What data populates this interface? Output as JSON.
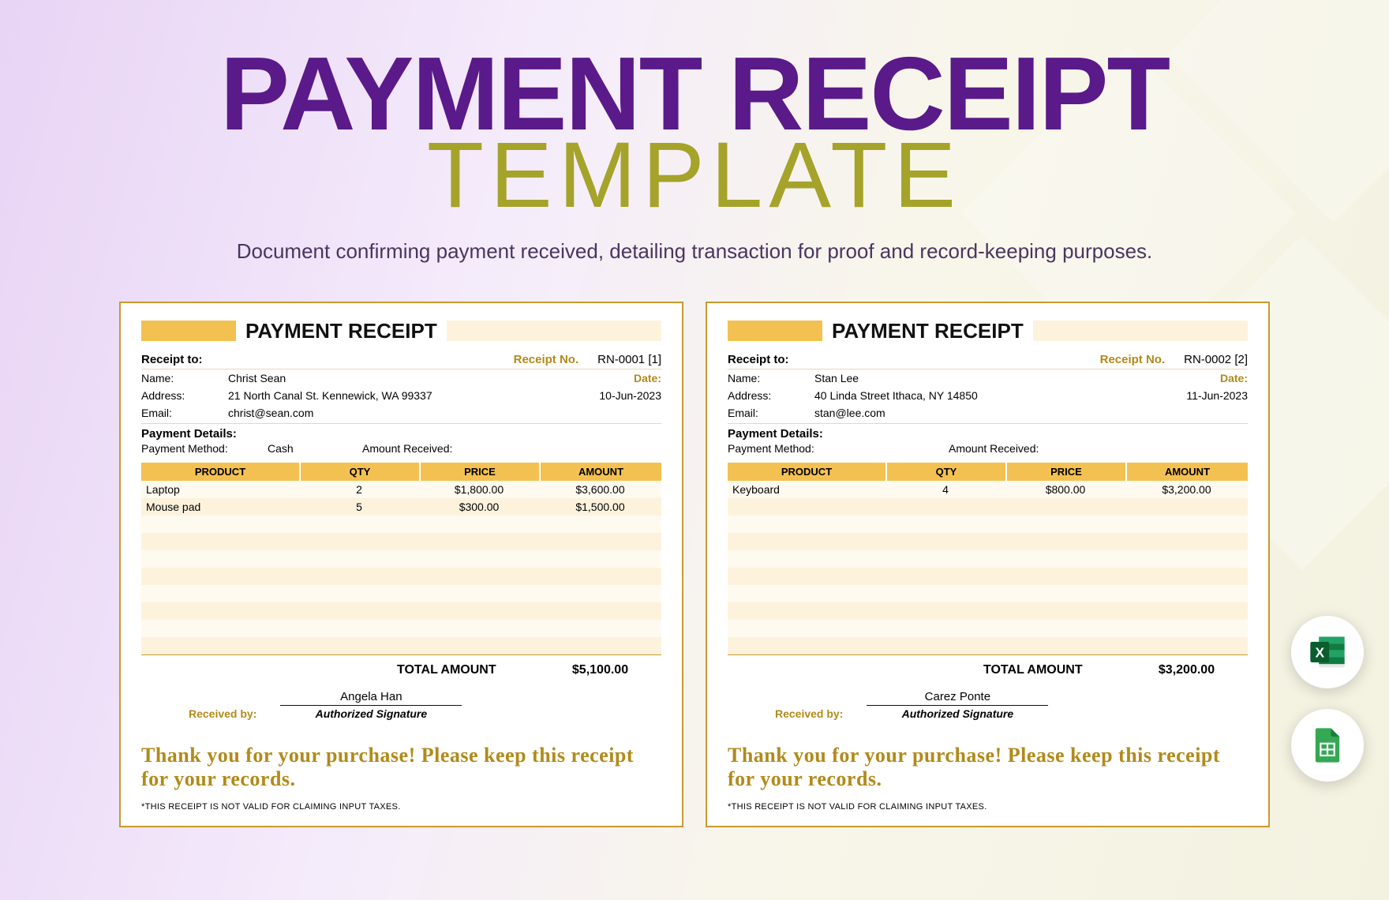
{
  "header": {
    "title_line1": "PAYMENT RECEIPT",
    "title_line2": "TEMPLATE",
    "description": "Document confirming payment received, detailing transaction for proof and record-keeping purposes."
  },
  "labels": {
    "receipt_title": "PAYMENT RECEIPT",
    "receipt_to": "Receipt to:",
    "receipt_no": "Receipt No.",
    "name": "Name:",
    "address": "Address:",
    "email": "Email:",
    "date": "Date:",
    "payment_details": "Payment Details:",
    "payment_method": "Payment Method:",
    "amount_received": "Amount Received:",
    "col_product": "PRODUCT",
    "col_qty": "QTY",
    "col_price": "PRICE",
    "col_amount": "AMOUNT",
    "total_amount": "TOTAL AMOUNT",
    "received_by": "Received by:",
    "authorized_sig": "Authorized Signature",
    "thanks": "Thank you for your purchase! Please keep this receipt for your records.",
    "disclaimer": "*THIS RECEIPT IS NOT VALID FOR CLAIMING INPUT TAXES."
  },
  "receipts": [
    {
      "receipt_no": "RN-0001 [1]",
      "date_text": "10-Jun-2023",
      "name": "Christ Sean",
      "address": "21 North Canal St. Kennewick, WA 99337",
      "email": "christ@sean.com",
      "payment_method": "Cash",
      "amount_received": "",
      "items": [
        {
          "product": "Laptop",
          "qty": "2",
          "price": "$1,800.00",
          "amount": "$3,600.00"
        },
        {
          "product": "Mouse pad",
          "qty": "5",
          "price": "$300.00",
          "amount": "$1,500.00"
        },
        {
          "product": "",
          "qty": "",
          "price": "",
          "amount": ""
        },
        {
          "product": "",
          "qty": "",
          "price": "",
          "amount": ""
        },
        {
          "product": "",
          "qty": "",
          "price": "",
          "amount": ""
        },
        {
          "product": "",
          "qty": "",
          "price": "",
          "amount": ""
        },
        {
          "product": "",
          "qty": "",
          "price": "",
          "amount": ""
        },
        {
          "product": "",
          "qty": "",
          "price": "",
          "amount": ""
        },
        {
          "product": "",
          "qty": "",
          "price": "",
          "amount": ""
        },
        {
          "product": "",
          "qty": "",
          "price": "",
          "amount": ""
        }
      ],
      "total": "$5,100.00",
      "received_by_name": "Angela Han"
    },
    {
      "receipt_no": "RN-0002 [2]",
      "date_text": "11-Jun-2023",
      "name": "Stan Lee",
      "address": "40 Linda Street Ithaca, NY 14850",
      "email": "stan@lee.com",
      "payment_method": "",
      "amount_received": "",
      "items": [
        {
          "product": "Keyboard",
          "qty": "4",
          "price": "$800.00",
          "amount": "$3,200.00"
        },
        {
          "product": "",
          "qty": "",
          "price": "",
          "amount": ""
        },
        {
          "product": "",
          "qty": "",
          "price": "",
          "amount": ""
        },
        {
          "product": "",
          "qty": "",
          "price": "",
          "amount": ""
        },
        {
          "product": "",
          "qty": "",
          "price": "",
          "amount": ""
        },
        {
          "product": "",
          "qty": "",
          "price": "",
          "amount": ""
        },
        {
          "product": "",
          "qty": "",
          "price": "",
          "amount": ""
        },
        {
          "product": "",
          "qty": "",
          "price": "",
          "amount": ""
        },
        {
          "product": "",
          "qty": "",
          "price": "",
          "amount": ""
        },
        {
          "product": "",
          "qty": "",
          "price": "",
          "amount": ""
        }
      ],
      "total": "$3,200.00",
      "received_by_name": "Carez Ponte"
    }
  ],
  "badges": {
    "excel": "excel-icon",
    "sheets": "sheets-icon"
  }
}
